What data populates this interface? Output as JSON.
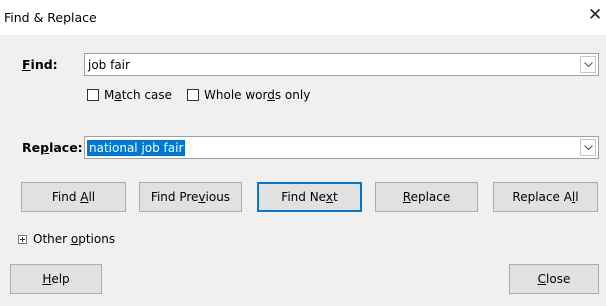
{
  "window": {
    "title": "Find & Replace",
    "close_glyph": "✕"
  },
  "find": {
    "label": "Find:",
    "value": "job fair"
  },
  "options": {
    "match_case": {
      "label": "Match case",
      "checked": false
    },
    "whole_words": {
      "label": "Whole words only",
      "checked": false
    }
  },
  "replace": {
    "label": "Replace:",
    "value": "national job fair"
  },
  "buttons": {
    "find_all": "Find All",
    "find_previous": "Find Previous",
    "find_next": "Find Next",
    "replace": "Replace",
    "replace_all": "Replace All"
  },
  "other_options": {
    "label": "Other options",
    "expanded": false
  },
  "footer": {
    "help": "Help",
    "close": "Close"
  },
  "icons": {
    "dropdown": "chevron-down-icon",
    "expander": "plus-box-icon",
    "close": "close-icon"
  },
  "colors": {
    "selection": "#0078d7",
    "default_button_border": "#0078d7",
    "dialog_bg": "#f0f0f0"
  }
}
